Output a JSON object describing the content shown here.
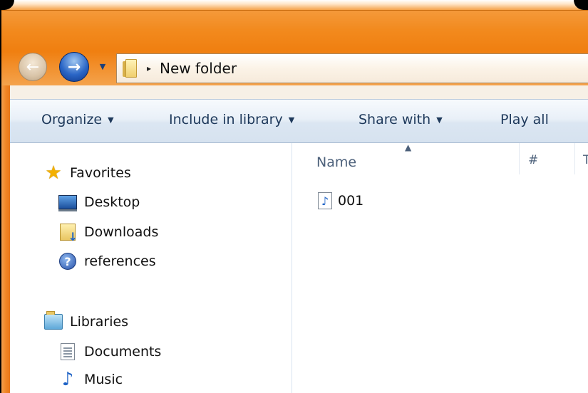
{
  "address": {
    "separator": "▸",
    "crumb": "New folder"
  },
  "toolbar": {
    "organize": "Organize",
    "include_in_library": "Include in library",
    "share_with": "Share with",
    "play_all": "Play all"
  },
  "navpane": {
    "favorites": {
      "header": "Favorites",
      "icon": "star-icon",
      "items": [
        {
          "label": "Desktop",
          "icon": "desktop-icon"
        },
        {
          "label": "Downloads",
          "icon": "downloads-folder-icon"
        },
        {
          "label": "references",
          "icon": "help-icon"
        }
      ]
    },
    "libraries": {
      "header": "Libraries",
      "icon": "libraries-icon",
      "items": [
        {
          "label": "Documents",
          "icon": "documents-icon"
        },
        {
          "label": "Music",
          "icon": "music-icon"
        }
      ]
    }
  },
  "filelist": {
    "columns": {
      "name": "Name",
      "number": "#",
      "title_partial": "T"
    },
    "files": [
      {
        "name": "001",
        "icon": "audio-file-icon"
      }
    ]
  },
  "colors": {
    "titlebar_orange": "#f28a1e",
    "toolbar_text": "#1e395b",
    "header_text": "#4c607a"
  }
}
